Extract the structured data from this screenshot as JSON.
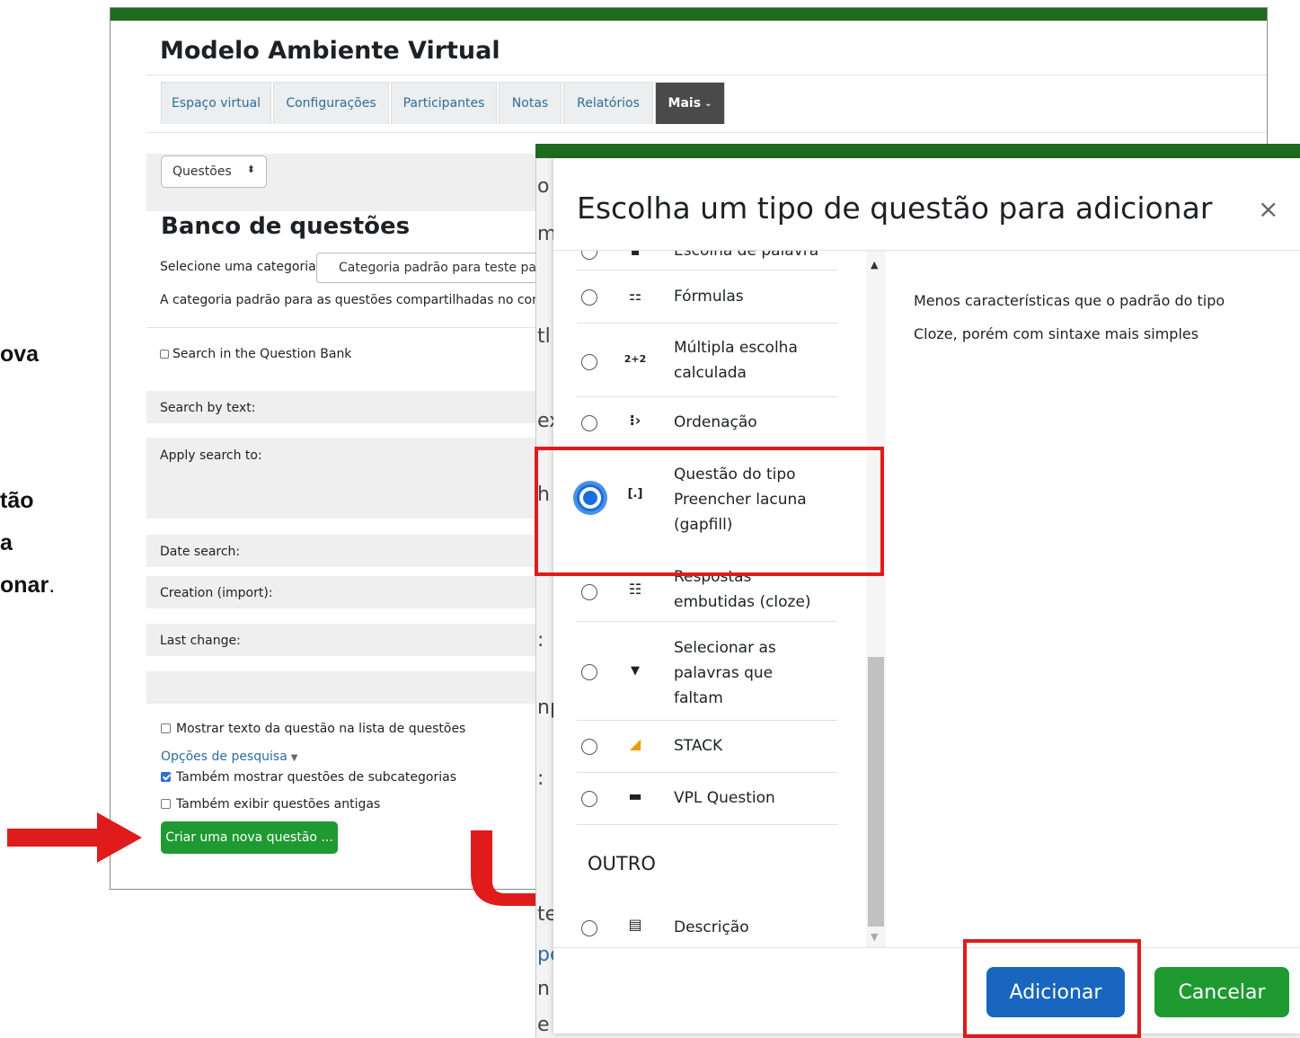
{
  "instructions": {
    "line1": "ova",
    "line2": "tão",
    "line3": "a",
    "line4_bold": "onar",
    "line4_rest": "."
  },
  "background_page": {
    "title": "Modelo Ambiente Virtual",
    "tabs": [
      "Espaço virtual",
      "Configurações",
      "Participantes",
      "Notas",
      "Relatórios",
      "Mais"
    ],
    "select_value": "Questões",
    "heading": "Banco de questões",
    "category_label": "Selecione uma categoria:",
    "category_value": "Categoria padrão para teste para",
    "category_desc": "A categoria padrão para as questões compartilhadas no contex",
    "search_in_bank": "Search in the Question Bank",
    "search_by_text": "Search by text:",
    "apply_search_to": "Apply search to:",
    "date_search": "Date search:",
    "creation": "Creation (import):",
    "last_change": "Last change:",
    "show_text": "Mostrar texto da questão na lista de questões",
    "search_options": "Opções de pesquisa",
    "show_subcategories": "Também mostrar questões de subcategorias",
    "show_old": "Também exibir questões antigas",
    "create_button": "Criar uma nova questão ..."
  },
  "behind_modal_fragments": [
    "o",
    "m",
    "tl",
    "ex",
    "h",
    ":",
    "np",
    ":",
    "te",
    "pe",
    "n",
    "e"
  ],
  "modal": {
    "title": "Escolha um tipo de questão para adicionar",
    "close": "×",
    "partial_top_label": "Escolha de palavra",
    "options": [
      {
        "label": "Fórmulas",
        "icon": "formulas-icon",
        "glyph": "⚏"
      },
      {
        "label": "Múltipla escolha calculada",
        "icon": "calculated-multichoice-icon",
        "glyph": "2+2"
      },
      {
        "label": "Ordenação",
        "icon": "ordering-icon",
        "glyph": "⁝›"
      },
      {
        "label": "Questão do tipo Preencher lacuna (gapfill)",
        "icon": "gapfill-icon",
        "glyph": "[.]",
        "selected": true
      },
      {
        "label": "Respostas embutidas (cloze)",
        "icon": "cloze-icon",
        "glyph": "☷"
      },
      {
        "label": "Selecionar as palavras que faltam",
        "icon": "dropdown-triangle-icon",
        "glyph": "▼"
      },
      {
        "label": "STACK",
        "icon": "stack-icon",
        "glyph": "◢"
      },
      {
        "label": "VPL Question",
        "icon": "vpl-icon",
        "glyph": "▬"
      }
    ],
    "section_other": "OUTRO",
    "other_options": [
      {
        "label": "Descrição",
        "icon": "description-icon",
        "glyph": "▤"
      }
    ],
    "description_line1": "Menos características que o padrão do tipo",
    "description_line2": "Cloze, porém com sintaxe mais simples",
    "add_button": "Adicionar",
    "cancel_button": "Cancelar"
  },
  "colors": {
    "moodle_green": "#1e6b1e",
    "primary_blue": "#1866bf",
    "success_green": "#1f9a31",
    "highlight_red": "#e01b1b"
  }
}
